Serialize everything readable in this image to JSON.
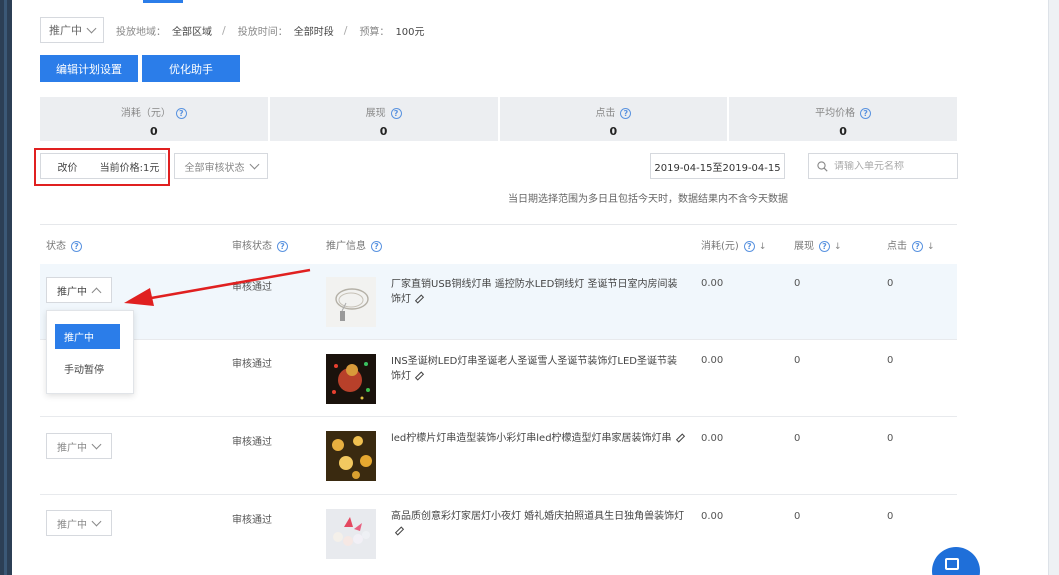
{
  "filters": {
    "status_select": "推广中",
    "region_label": "投放地域：",
    "region_value": "全部区域",
    "time_label": "投放时间：",
    "time_value": "全部时段",
    "budget_label": "预算：",
    "budget_value": "100元",
    "separator": "/"
  },
  "buttons": {
    "edit_plan": "编辑计划设置",
    "optimize": "优化助手",
    "change_price": "改价",
    "current_price": "当前价格:1元",
    "review_status": "全部审核状态"
  },
  "stats": [
    {
      "label": "消耗（元）",
      "value": "0"
    },
    {
      "label": "展现",
      "value": "0"
    },
    {
      "label": "点击",
      "value": "0"
    },
    {
      "label": "平均价格",
      "value": "0"
    }
  ],
  "date_range": "2019-04-15至2019-04-15",
  "search": {
    "placeholder": "请输入单元名称"
  },
  "note": "当日期选择范围为多日且包括今天时，数据结果内不含今天数据",
  "table": {
    "headers": {
      "status": "状态",
      "review": "审核状态",
      "info": "推广信息",
      "cost": "消耗(元)",
      "impressions": "展现",
      "clicks": "点击"
    },
    "rows": [
      {
        "status": "推广中",
        "review": "审核通过",
        "title": "厂家直销USB铜线灯串 遥控防水LED铜线灯 圣诞节日室内房间装饰灯",
        "cost": "0.00",
        "impressions": "0",
        "clicks": "0"
      },
      {
        "status": "推广中",
        "review": "审核通过",
        "title": "INS圣诞树LED灯串圣诞老人圣诞雪人圣诞节装饰灯LED圣诞节装饰灯",
        "cost": "0.00",
        "impressions": "0",
        "clicks": "0"
      },
      {
        "status": "推广中",
        "review": "审核通过",
        "title": "led柠檬片灯串造型装饰小彩灯串led柠檬造型灯串家居装饰灯串",
        "cost": "0.00",
        "impressions": "0",
        "clicks": "0"
      },
      {
        "status": "推广中",
        "review": "审核通过",
        "title": "高品质创意彩灯家居灯小夜灯 婚礼婚庆拍照道具生日独角兽装饰灯",
        "cost": "0.00",
        "impressions": "0",
        "clicks": "0"
      }
    ]
  },
  "dropdown": {
    "options": [
      "推广中",
      "手动暂停"
    ]
  },
  "colors": {
    "primary": "#2b7de9",
    "highlight": "#e02020",
    "row_highlight": "#f1f7fc"
  }
}
